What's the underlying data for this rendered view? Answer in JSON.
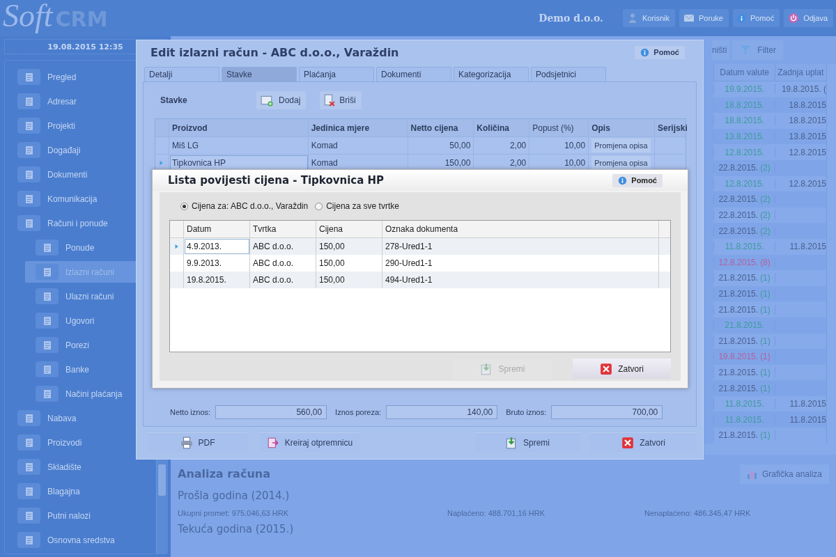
{
  "header": {
    "logo_soft": "Soft",
    "logo_crm": "CRM",
    "company": "Demo d.o.o.",
    "buttons": [
      {
        "label": "Korisnik"
      },
      {
        "label": "Poruke"
      },
      {
        "label": "Pomoć"
      },
      {
        "label": "Odjava"
      }
    ]
  },
  "datetime": "19.08.2015 12:35",
  "sidebar": {
    "items": [
      {
        "label": "Pregled",
        "selected": false
      },
      {
        "label": "Adresar",
        "selected": false
      },
      {
        "label": "Projekti",
        "selected": false
      },
      {
        "label": "Događaji",
        "selected": false
      },
      {
        "label": "Dokumenti",
        "selected": false
      },
      {
        "label": "Komunikacija",
        "selected": false
      },
      {
        "label": "Računi i ponude",
        "selected": false,
        "children": [
          {
            "label": "Ponude",
            "selected": false
          },
          {
            "label": "Izlazni računi",
            "selected": true
          },
          {
            "label": "Ulazni računi",
            "selected": false
          },
          {
            "label": "Ugovori",
            "selected": false
          },
          {
            "label": "Porezi",
            "selected": false
          },
          {
            "label": "Banke",
            "selected": false
          },
          {
            "label": "Načini plaćanja",
            "selected": false
          }
        ]
      },
      {
        "label": "Nabava",
        "selected": false
      },
      {
        "label": "Proizvodi",
        "selected": false
      },
      {
        "label": "Skladište",
        "selected": false
      },
      {
        "label": "Blagajna",
        "selected": false
      },
      {
        "label": "Putni nalozi",
        "selected": false
      },
      {
        "label": "Osnovna sredstva",
        "selected": false
      }
    ]
  },
  "toolbar": {
    "items": [
      {
        "label": "ništi"
      },
      {
        "label": "Filter"
      }
    ]
  },
  "invoice_table": {
    "columns": [
      "Datum valute",
      "Zadnja uplat"
    ],
    "rows": [
      {
        "due_date": "19.9.2015.",
        "color": "#3f9a9c",
        "last_payment": "19.8.2015. ("
      },
      {
        "due_date": "18.8.2015.",
        "color": "#3f9a9c",
        "last_payment": "18.8.2015"
      },
      {
        "due_date": "18.8.2015.",
        "color": "#3f9a9c",
        "last_payment": "18.8.2015"
      },
      {
        "due_date": "13.8.2015.",
        "color": "#3f9a9c",
        "last_payment": "13.8.2015"
      },
      {
        "due_date": "12.8.2015.",
        "color": "#3f9a9c",
        "last_payment": "12.8.2015"
      },
      {
        "due_date": "22.8.2015.",
        "color": "#4b5f8c",
        "count": {
          "text": "(2)",
          "color": "#3f9a9c"
        }
      },
      {
        "due_date": "12.8.2015.",
        "color": "#3f9a9c",
        "last_payment": "12.8.2015"
      },
      {
        "due_date": "22.8.2015.",
        "color": "#4b5f8c",
        "count": {
          "text": "(2)",
          "color": "#3f9a9c"
        }
      },
      {
        "due_date": "22.8.2015.",
        "color": "#4b5f8c",
        "count": {
          "text": "(2)",
          "color": "#3f9a9c"
        }
      },
      {
        "due_date": "22.8.2015.",
        "color": "#4b5f8c",
        "count": {
          "text": "(2)",
          "color": "#3f9a9c"
        }
      },
      {
        "due_date": "11.8.2015.",
        "color": "#3f9a9c",
        "last_payment": "11.8.2015"
      },
      {
        "due_date": "12.8.2015.",
        "color": "#b45f9e",
        "count": {
          "text": "(8)",
          "color": "#b45f9e"
        }
      },
      {
        "due_date": "21.8.2015.",
        "color": "#4b5f8c",
        "count": {
          "text": "(1)",
          "color": "#3f9a9c"
        }
      },
      {
        "due_date": "21.8.2015.",
        "color": "#4b5f8c",
        "count": {
          "text": "(1)",
          "color": "#3f9a9c"
        }
      },
      {
        "due_date": "21.8.2015.",
        "color": "#4b5f8c",
        "count": {
          "text": "(1)",
          "color": "#3f9a9c"
        }
      },
      {
        "due_date": "21.8.2015.",
        "color": "#3f9a9c"
      },
      {
        "due_date": "21.8.2015.",
        "color": "#4b5f8c",
        "count": {
          "text": "(1)",
          "color": "#3f9a9c"
        }
      },
      {
        "due_date": "19.8.2015.",
        "color": "#b45f9e",
        "count": {
          "text": "(1)",
          "color": "#b45f9e"
        }
      },
      {
        "due_date": "21.8.2015.",
        "color": "#4b5f8c",
        "count": {
          "text": "(1)",
          "color": "#3f9a9c"
        }
      },
      {
        "due_date": "21.8.2015.",
        "color": "#4b5f8c",
        "count": {
          "text": "(1)",
          "color": "#3f9a9c"
        }
      },
      {
        "due_date": "11.8.2015.",
        "color": "#3f9a9c",
        "last_payment": "11.8.2015"
      },
      {
        "due_date": "11.8.2015.",
        "color": "#3f9a9c",
        "last_payment": "11.8.2015"
      },
      {
        "due_date": "21.8.2015.",
        "color": "#4b5f8c",
        "count": {
          "text": "(1)",
          "color": "#3f9a9c"
        }
      }
    ]
  },
  "analysis": {
    "title": "Analiza računa",
    "chart_button": "Grafička analiza",
    "previous_year": "Prošla godina (2014.)",
    "stats": [
      "Ukupni promet: 975.046,63 HRK",
      "Naplaćeno: 488.701,16 HRK",
      "Nenaplaćeno: 486.345,47 HRK"
    ],
    "current_year": "Tekuća godina (2015.)"
  },
  "edit_dialog": {
    "title": "Edit izlazni račun - ABC d.o.o., Varaždin",
    "help": "Pomoć",
    "tabs": [
      {
        "label": "Detalji",
        "selected": false
      },
      {
        "label": "Stavke",
        "selected": true
      },
      {
        "label": "Plaćanja",
        "selected": false
      },
      {
        "label": "Dokumenti",
        "selected": false
      },
      {
        "label": "Kategorizacija",
        "selected": false
      },
      {
        "label": "Podsjetnici",
        "selected": false
      }
    ],
    "section_label": "Stavke",
    "actions": [
      "Dodaj",
      "Briši"
    ],
    "columns": [
      "Proizvod",
      "Jedinica mjere",
      "Netto cijena",
      "Količina",
      "Popust (%)",
      "Opis",
      "Serijski"
    ],
    "rows": [
      {
        "cells": [
          "Miš LG",
          "Komad",
          "50,00",
          "2,00",
          "10,00"
        ],
        "description_button": "Promjena opisa",
        "selected": false
      },
      {
        "cells": [
          "Tipkovnica HP",
          "Komad",
          "150,00",
          "2,00",
          "10,00"
        ],
        "description_button": "Promjena opisa",
        "selected": true
      }
    ],
    "totals": [
      {
        "label": "Netto iznos:",
        "value": "560,00"
      },
      {
        "label": "Iznos poreza:",
        "value": "140,00"
      },
      {
        "label": "Bruto iznos:",
        "value": "700,00"
      }
    ],
    "buttons": [
      "PDF",
      "Kreiraj otpremnicu",
      "Spremi",
      "Zatvori"
    ]
  },
  "price_history_dialog": {
    "title": "Lista povijesti cijena - Tipkovnica HP",
    "help": "Pomoć",
    "options": [
      {
        "label": "Cijena za: ABC d.o.o., Varaždin",
        "selected": true
      },
      {
        "label": "Cijena za sve tvrtke",
        "selected": false
      }
    ],
    "columns": [
      "Datum",
      "Tvrtka",
      "Cijena",
      "Oznaka dokumenta"
    ],
    "rows": [
      {
        "cells": [
          "4.9.2013.",
          "ABC d.o.o.",
          "150,00",
          "278-Ured1-1"
        ],
        "selected": true
      },
      {
        "cells": [
          "9.9.2013.",
          "ABC d.o.o.",
          "150,00",
          "290-Ured1-1"
        ],
        "selected": false
      },
      {
        "cells": [
          "19.8.2015.",
          "ABC d.o.o.",
          "150,00",
          "494-Ured1-1"
        ],
        "selected": false
      }
    ],
    "buttons": [
      {
        "label": "Spremi",
        "disabled": true
      },
      {
        "label": "Zatvori",
        "disabled": false
      }
    ]
  }
}
